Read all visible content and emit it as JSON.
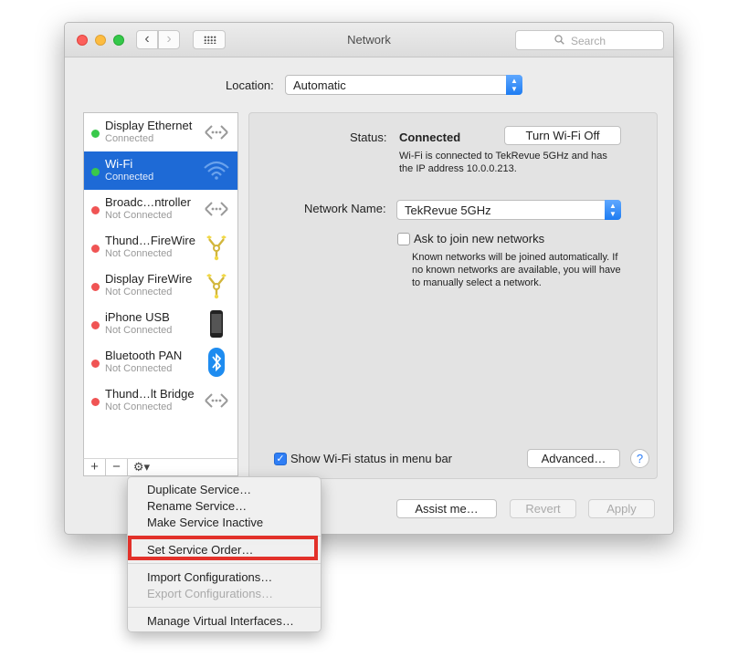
{
  "window": {
    "title": "Network"
  },
  "search": {
    "placeholder": "Search"
  },
  "location": {
    "label": "Location:",
    "value": "Automatic"
  },
  "services": [
    {
      "name": "Display Ethernet",
      "status": "Connected",
      "state": "green",
      "icon": "ethernet-icon"
    },
    {
      "name": "Wi-Fi",
      "status": "Connected",
      "state": "green",
      "icon": "wifi-icon",
      "selected": true
    },
    {
      "name": "Broadc…ntroller",
      "status": "Not Connected",
      "state": "red",
      "icon": "ethernet-icon"
    },
    {
      "name": "Thund…FireWire",
      "status": "Not Connected",
      "state": "red",
      "icon": "firewire-icon"
    },
    {
      "name": "Display FireWire",
      "status": "Not Connected",
      "state": "red",
      "icon": "firewire-icon"
    },
    {
      "name": "iPhone USB",
      "status": "Not Connected",
      "state": "red",
      "icon": "iphone-icon"
    },
    {
      "name": "Bluetooth PAN",
      "status": "Not Connected",
      "state": "red",
      "icon": "bluetooth-icon"
    },
    {
      "name": "Thund…lt Bridge",
      "status": "Not Connected",
      "state": "red",
      "icon": "ethernet-icon"
    }
  ],
  "toolbar": {
    "add": "+",
    "remove": "−",
    "gear": "⚙▾"
  },
  "detail": {
    "status_label": "Status:",
    "status_value": "Connected",
    "turn_off_button": "Turn Wi-Fi Off",
    "status_desc": "Wi-Fi is connected to TekRevue 5GHz and has the IP address 10.0.0.213.",
    "network_name_label": "Network Name:",
    "network_name_value": "TekRevue 5GHz",
    "ask_label": "Ask to join new networks",
    "ask_checked": false,
    "ask_desc": "Known networks will be joined automatically. If no known networks are available, you will have to manually select a network.",
    "show_status_label": "Show Wi-Fi status in menu bar",
    "show_status_checked": true,
    "advanced_button": "Advanced…",
    "help": "?"
  },
  "footer": {
    "assist": "Assist me…",
    "revert": "Revert",
    "apply": "Apply"
  },
  "menu": {
    "items": [
      {
        "label": "Duplicate Service…",
        "enabled": true
      },
      {
        "label": "Rename Service…",
        "enabled": true
      },
      {
        "label": "Make Service Inactive",
        "enabled": true
      },
      {
        "label": "Set Service Order…",
        "enabled": true,
        "highlighted": true
      },
      {
        "label": "Import Configurations…",
        "enabled": true
      },
      {
        "label": "Export Configurations…",
        "enabled": false
      },
      {
        "label": "Manage Virtual Interfaces…",
        "enabled": true
      }
    ]
  },
  "colors": {
    "selection": "#1e6ad6",
    "connected": "#39c94b",
    "disconnected": "#f05454",
    "highlight": "#e2312a"
  }
}
